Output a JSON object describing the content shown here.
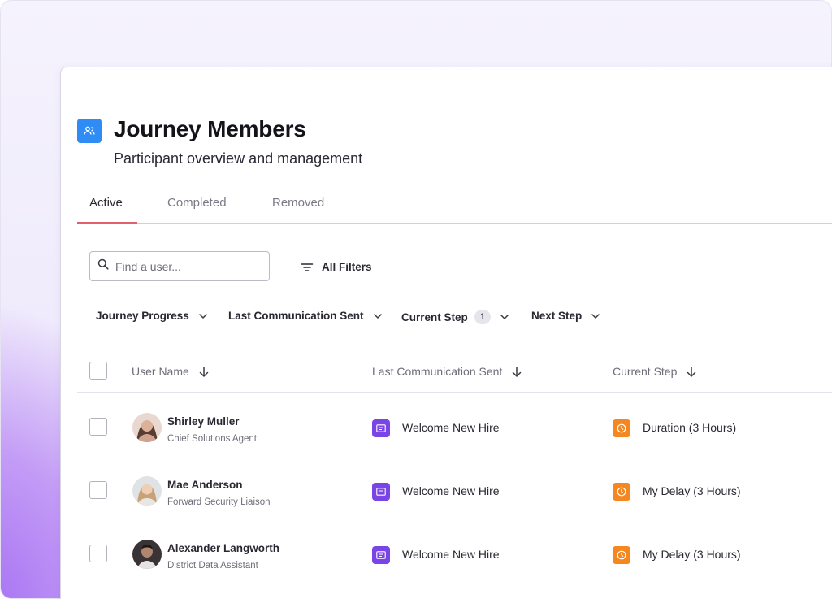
{
  "header": {
    "title": "Journey Members",
    "subtitle": "Participant overview and management"
  },
  "tabs": [
    {
      "label": "Active",
      "active": true
    },
    {
      "label": "Completed",
      "active": false
    },
    {
      "label": "Removed",
      "active": false
    }
  ],
  "search": {
    "placeholder": "Find a user...",
    "value": ""
  },
  "all_filters_label": "All Filters",
  "filters": [
    {
      "label": "Journey Progress"
    },
    {
      "label": "Last Communication Sent"
    },
    {
      "label": "Current Step",
      "badge": "1"
    },
    {
      "label": "Next Step"
    }
  ],
  "table": {
    "columns": [
      "User Name",
      "Last Communication Sent",
      "Current Step"
    ],
    "rows": [
      {
        "name": "Shirley Muller",
        "role": "Chief Solutions Agent",
        "communication": "Welcome New Hire",
        "step": "Duration (3 Hours)"
      },
      {
        "name": "Mae Anderson",
        "role": "Forward Security Liaison",
        "communication": "Welcome New Hire",
        "step": "My Delay (3 Hours)"
      },
      {
        "name": "Alexander Langworth",
        "role": "District Data Assistant",
        "communication": "Welcome New Hire",
        "step": "My Delay (3 Hours)"
      }
    ]
  },
  "colors": {
    "header_icon": "#2f8cf5",
    "tab_underline": "#e0606b",
    "communication_icon": "#7a45e6",
    "step_icon": "#f4871f"
  },
  "icons": {
    "header": "users-icon",
    "search": "search-icon",
    "filters": "filter-lines-icon",
    "sort": "arrow-down-icon",
    "dropdown": "chevron-down-icon",
    "communication": "message-icon",
    "step": "clock-icon"
  }
}
